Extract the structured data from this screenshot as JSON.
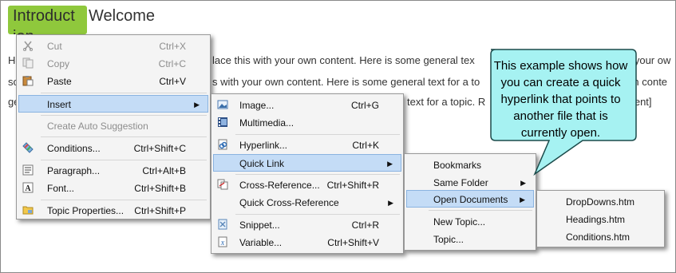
{
  "page": {
    "intro_tag": "Introduct ion",
    "heading": "Welcome",
    "text_line1_left": "He",
    "text_line1_mid": "lace this with your own content. Here is some general tex",
    "text_line1_right": "h your ow",
    "text_line2_left": "so",
    "text_line2_mid": "s with your own content. Here is some general text for a to",
    "text_line2_right": "wn conte",
    "text_line3_left": "ge",
    "text_line3_mid": "text for a topic. R",
    "text_line3_right": "ntent]"
  },
  "context_menu": {
    "cut": {
      "label": "Cut",
      "shortcut": "Ctrl+X",
      "icon": "scissors-icon"
    },
    "copy": {
      "label": "Copy",
      "shortcut": "Ctrl+C",
      "icon": "copy-icon"
    },
    "paste": {
      "label": "Paste",
      "shortcut": "Ctrl+V",
      "icon": "paste-icon"
    },
    "insert": {
      "label": "Insert"
    },
    "create_auto_suggestion": {
      "label": "Create Auto Suggestion"
    },
    "conditions": {
      "label": "Conditions...",
      "shortcut": "Ctrl+Shift+C",
      "icon": "conditions-icon"
    },
    "paragraph": {
      "label": "Paragraph...",
      "shortcut": "Ctrl+Alt+B",
      "icon": "paragraph-icon"
    },
    "font": {
      "label": "Font...",
      "shortcut": "Ctrl+Shift+B",
      "icon": "font-icon"
    },
    "topic_properties": {
      "label": "Topic Properties...",
      "shortcut": "Ctrl+Shift+P",
      "icon": "topic-properties-icon"
    }
  },
  "insert_menu": {
    "image": {
      "label": "Image...",
      "shortcut": "Ctrl+G",
      "icon": "image-icon"
    },
    "multimedia": {
      "label": "Multimedia...",
      "icon": "multimedia-icon"
    },
    "hyperlink": {
      "label": "Hyperlink...",
      "shortcut": "Ctrl+K",
      "icon": "hyperlink-icon"
    },
    "quick_link": {
      "label": "Quick Link"
    },
    "cross_reference": {
      "label": "Cross-Reference...",
      "shortcut": "Ctrl+Shift+R",
      "icon": "cross-reference-icon"
    },
    "quick_cross_reference": {
      "label": "Quick Cross-Reference"
    },
    "snippet": {
      "label": "Snippet...",
      "shortcut": "Ctrl+R",
      "icon": "snippet-icon"
    },
    "variable": {
      "label": "Variable...",
      "shortcut": "Ctrl+Shift+V",
      "icon": "variable-icon"
    }
  },
  "quick_link_menu": {
    "bookmarks": "Bookmarks",
    "same_folder": "Same Folder",
    "open_documents": "Open Documents",
    "new_topic": "New Topic...",
    "topic": "Topic..."
  },
  "open_documents_menu": {
    "items": [
      "DropDowns.htm",
      "Headings.htm",
      "Conditions.htm"
    ]
  },
  "callout": {
    "text": "This example shows how you can create a quick hyperlink that points to another file that is currently open."
  },
  "colors": {
    "highlight": "#c4dcf6",
    "callout_fill": "#a6f2f2",
    "intro_tag": "#8fc83c"
  }
}
